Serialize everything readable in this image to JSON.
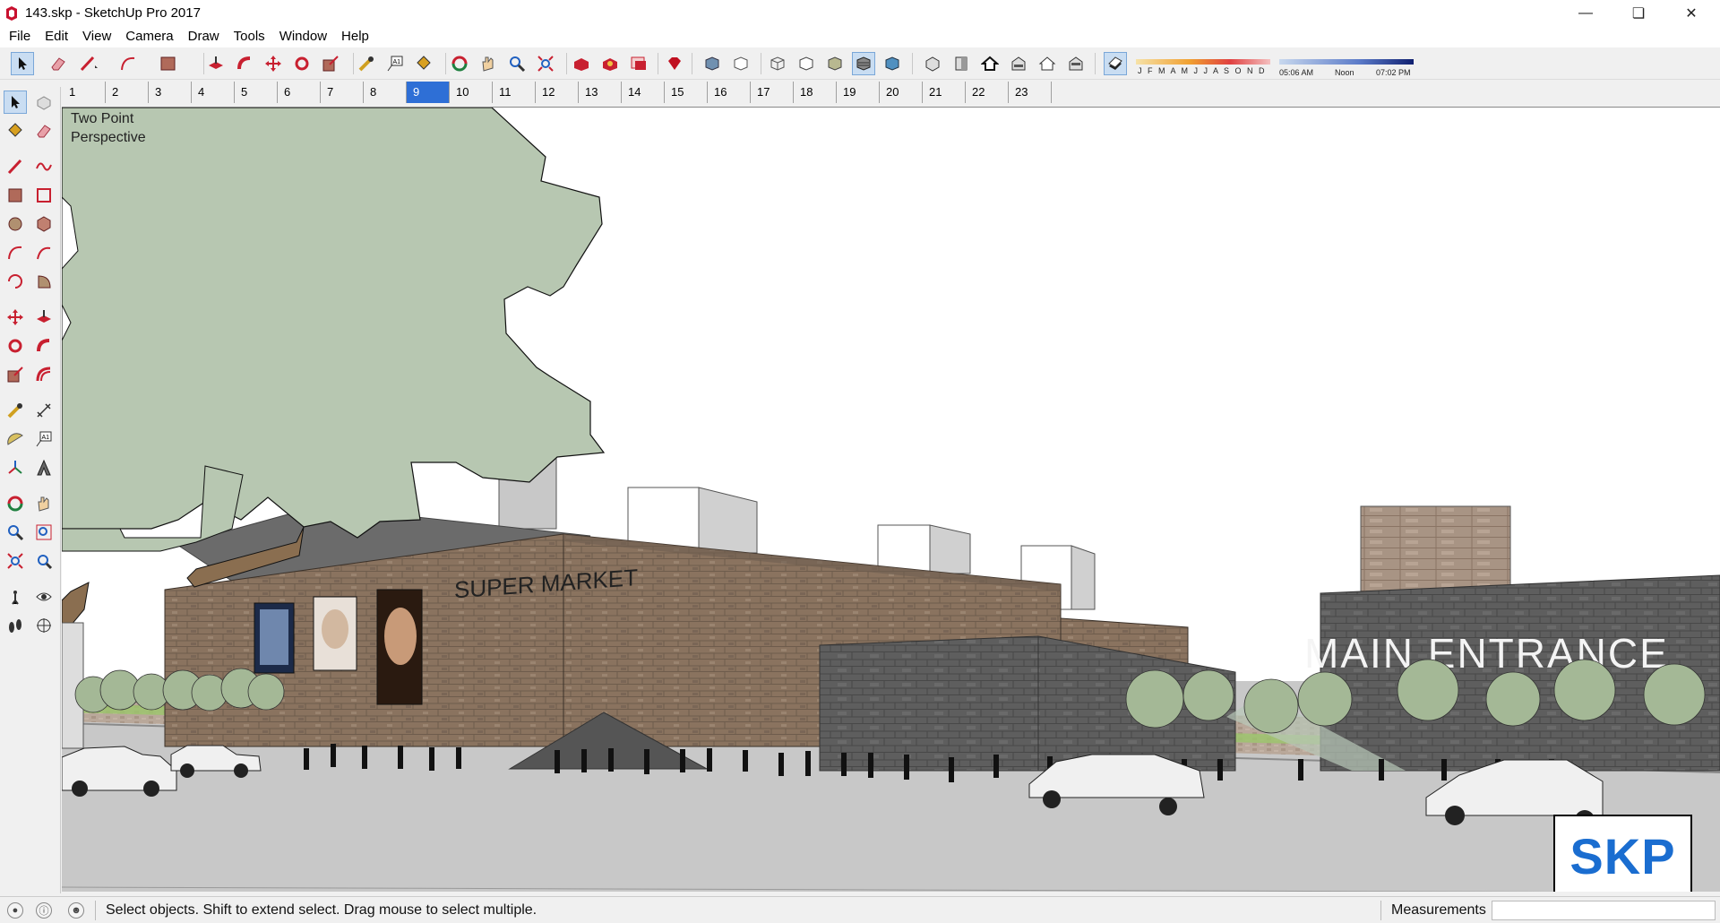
{
  "window": {
    "title": "143.skp - SketchUp Pro 2017",
    "controls": [
      "minimize",
      "restore",
      "close"
    ]
  },
  "menu": [
    "File",
    "Edit",
    "View",
    "Camera",
    "Draw",
    "Tools",
    "Window",
    "Help"
  ],
  "toolbar": {
    "icons": [
      "select-icon",
      "eraser-icon",
      "line-icon",
      "arc-icon",
      "rectangle-icon",
      "push-pull-icon",
      "follow-me-icon",
      "move-icon",
      "rotate-icon",
      "scale-icon",
      "tape-measure-icon",
      "text-icon",
      "paint-bucket-icon",
      "orbit-icon",
      "pan-icon",
      "zoom-icon",
      "zoom-extents-icon",
      "warehouse-icon",
      "extension-warehouse-icon",
      "send-to-layout-icon",
      "ruby-console-icon",
      "xray-icon",
      "back-edges-icon",
      "wireframe-icon",
      "hidden-line-icon",
      "shaded-icon",
      "shaded-textures-icon",
      "monochrome-icon",
      "iso-view-icon",
      "front-view-icon",
      "home-view-icon",
      "right-view-icon",
      "back-view-icon",
      "left-view-icon",
      "shadows-toggle-icon"
    ],
    "shadow_panel": {
      "months": "J F M A M J J A S O N D",
      "time_start": "05:06 AM",
      "time_mid": "Noon",
      "time_end": "07:02 PM"
    }
  },
  "scenes": {
    "tabs": [
      "1",
      "2",
      "3",
      "4",
      "5",
      "6",
      "7",
      "8",
      "9",
      "10",
      "11",
      "12",
      "13",
      "14",
      "15",
      "16",
      "17",
      "18",
      "19",
      "20",
      "21",
      "22",
      "23"
    ],
    "active": "9"
  },
  "left_tools": [
    "select-icon",
    "component-icon",
    "paint-bucket-icon",
    "eraser-icon",
    "line-icon",
    "freehand-icon",
    "rectangle-icon",
    "rotated-rectangle-icon",
    "circle-icon",
    "polygon-icon",
    "arc-icon",
    "two-point-arc-icon",
    "three-point-arc-icon",
    "pie-icon",
    "move-icon",
    "push-pull-icon",
    "rotate-icon",
    "follow-me-icon",
    "scale-icon",
    "offset-icon",
    "tape-measure-icon",
    "dimension-icon",
    "protractor-icon",
    "text-icon",
    "axes-icon",
    "3d-text-icon",
    "orbit-icon",
    "pan-icon",
    "zoom-icon",
    "zoom-window-icon",
    "zoom-extents-icon",
    "previous-view-icon",
    "position-camera-icon",
    "look-around-icon",
    "walk-icon",
    "section-plane-icon"
  ],
  "viewport": {
    "view_label": "Two Point\nPerspective",
    "sign_supermarket": "SUPER MARKET",
    "sign_entrance": "MAIN ENTRANCE",
    "badge": "SKP"
  },
  "status": {
    "message": "Select objects. Shift to extend select. Drag mouse to select multiple.",
    "measurements_label": "Measurements",
    "measurements_value": ""
  },
  "colors": {
    "app_red": "#c8102e",
    "active_blue": "#2e6fd6",
    "skp_blue": "#1a6dd0",
    "brick": "#8a735f",
    "stone_gray": "#5f5f5f",
    "tree_green": "#b7c7b1"
  }
}
